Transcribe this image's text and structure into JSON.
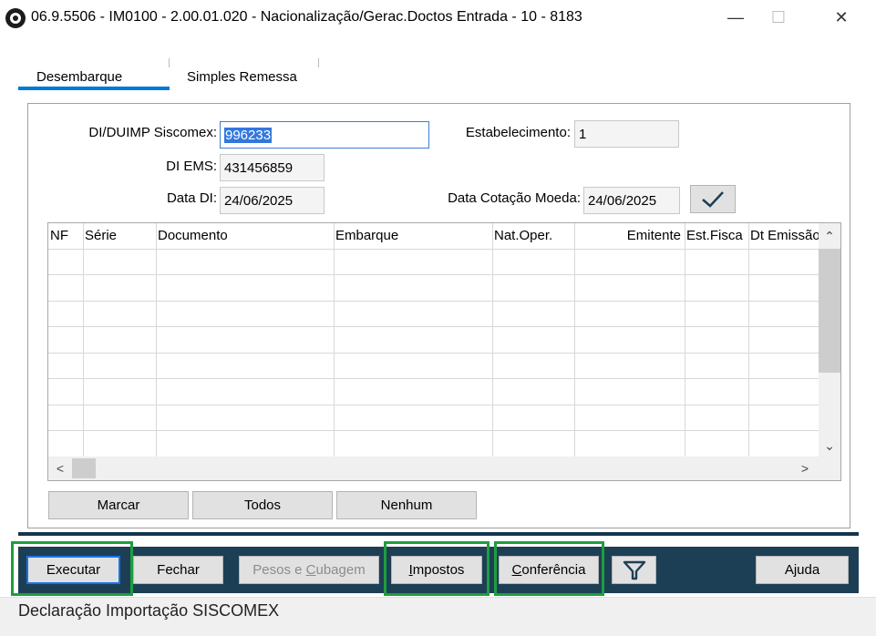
{
  "window": {
    "title": "06.9.5506 - IM0100 - 2.00.01.020 - Nacionalização/Gerac.Doctos Entrada - 10 - 8183",
    "minimize_glyph": "—",
    "maximize_glyph": "☐",
    "close_glyph": "✕"
  },
  "tabs": [
    {
      "label": "Desembarque",
      "active": true
    },
    {
      "label": "Simples Remessa",
      "active": false
    }
  ],
  "form": {
    "di_label": "DI/DUIMP Siscomex:",
    "di_value": "996233",
    "di_ems_label": "DI EMS:",
    "di_ems_value": "431456859",
    "data_di_label": "Data DI:",
    "data_di_value": "24/06/2025",
    "estab_label": "Estabelecimento:",
    "estab_value": "1",
    "cotacao_label": "Data Cotação Moeda:",
    "cotacao_value": "24/06/2025"
  },
  "grid": {
    "columns": [
      "NF",
      "Série",
      "Documento",
      "Embarque",
      "Nat.Oper.",
      "Emitente",
      "Est.Fisca",
      "Dt Emissão"
    ],
    "rows": [],
    "scroll_up": "⌃",
    "scroll_down": "⌄",
    "scroll_left": "<",
    "scroll_right": ">"
  },
  "grid_buttons": {
    "marcar": "Marcar",
    "todos": "Todos",
    "nenhum": "Nenhum"
  },
  "toolbar": {
    "executar": "Executar",
    "fechar": "Fechar",
    "pesos_pre": "Pesos e ",
    "pesos_u": "C",
    "pesos_post": "ubagem",
    "impostos_u": "I",
    "impostos_post": "mpostos",
    "conferencia_u": "C",
    "conferencia_post": "onferência",
    "ajuda": "Ajuda"
  },
  "status": {
    "text": "Declaração Importação SISCOMEX"
  },
  "colors": {
    "toolbar_bg": "#1d3f55",
    "highlight": "#1e9e3e",
    "tab_accent": "#0078d7"
  }
}
